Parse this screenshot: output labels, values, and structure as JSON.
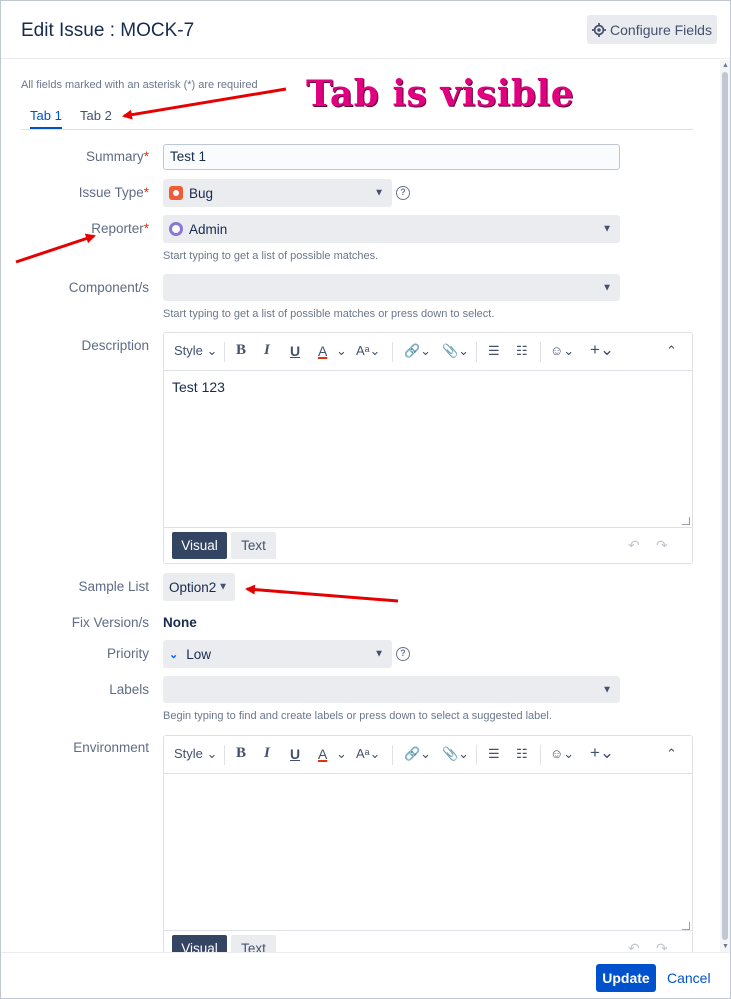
{
  "dialog": {
    "title": "Edit Issue : MOCK-7",
    "configure_label": "Configure Fields"
  },
  "form": {
    "required_note": "All fields marked with an asterisk (*) are required",
    "tabs": [
      {
        "label": "Tab 1",
        "active": true
      },
      {
        "label": "Tab 2",
        "active": false
      }
    ],
    "summary": {
      "label": "Summary",
      "required_mark": "*",
      "value": "Test 1"
    },
    "issue_type": {
      "label": "Issue Type",
      "required_mark": "*",
      "value": "Bug",
      "icon": "bug-icon"
    },
    "reporter": {
      "label": "Reporter",
      "required_mark": "*",
      "value": "Admin",
      "help": "Start typing to get a list of possible matches.",
      "icon": "avatar"
    },
    "components": {
      "label": "Component/s",
      "value": "",
      "help": "Start typing to get a list of possible matches or press down to select."
    },
    "description": {
      "label": "Description",
      "text": "Test 123",
      "toolbar": {
        "style": "Style",
        "bold": "B",
        "italic": "I",
        "underline": "U",
        "color": "A"
      },
      "mode_visual": "Visual",
      "mode_text": "Text"
    },
    "sample_list": {
      "label": "Sample List",
      "value": "Option2"
    },
    "fix_versions": {
      "label": "Fix Version/s",
      "value": "None"
    },
    "priority": {
      "label": "Priority",
      "value": "Low",
      "icon": "priority-low-icon"
    },
    "labels": {
      "label": "Labels",
      "value": "",
      "help": "Begin typing to find and create labels or press down to select a suggested label."
    },
    "environment": {
      "label": "Environment",
      "text": "",
      "toolbar": {
        "style": "Style",
        "bold": "B",
        "italic": "I",
        "underline": "U",
        "color": "A"
      },
      "mode_visual": "Visual",
      "mode_text": "Text"
    }
  },
  "footer": {
    "update_label": "Update",
    "cancel_label": "Cancel"
  },
  "annotation": {
    "text": "Tab is visible",
    "color": "#e00080",
    "arrow_color": "#e60000"
  },
  "colors": {
    "primary": "#0052cc",
    "required": "#de350b",
    "bug": "#f05c39"
  }
}
